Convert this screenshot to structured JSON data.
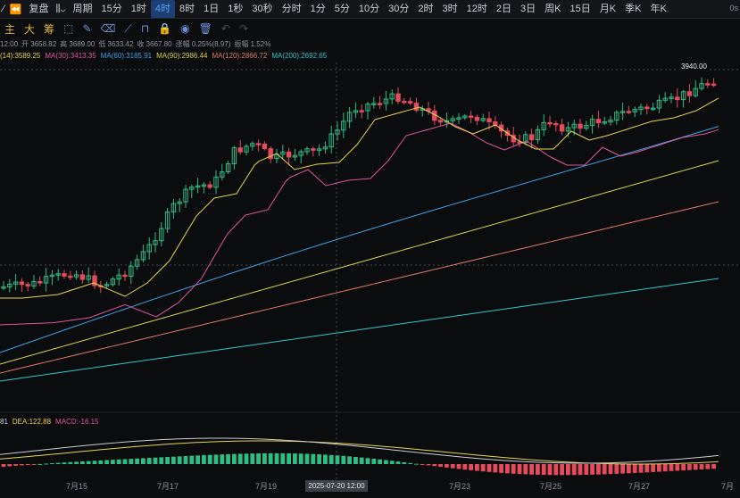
{
  "toolbar": {
    "replay_label": "复盘",
    "period_label": "周期",
    "timeframes": [
      "15分",
      "1时",
      "4时",
      "8时",
      "1日",
      "1秒",
      "30秒",
      "分时",
      "1分",
      "5分",
      "10分",
      "30分",
      "2时",
      "3时",
      "12时",
      "2日",
      "3日",
      "周K",
      "15日",
      "月K",
      "季K",
      "年K"
    ],
    "active_timeframe": "4时",
    "right_text": "0s"
  },
  "tools": {
    "indicators": [
      "主",
      "大",
      "筹"
    ]
  },
  "ohlc": {
    "time_fragment": "12:00",
    "open": "开 3658.82",
    "high": "高 3689.00",
    "low": "低 3633.42",
    "close": "收 3667.80",
    "change": "涨幅 0.25%(8.97)",
    "amplitude": "振幅 1.52%"
  },
  "ma": [
    {
      "label": "(14):3589.25",
      "color": "#e8d44d"
    },
    {
      "label": "MA(30):3413.35",
      "color": "#e0569a"
    },
    {
      "label": "MA(60):3185.91",
      "color": "#3aa0e8"
    },
    {
      "label": "MA(90):2986.44",
      "color": "#d9d24a"
    },
    {
      "label": "MA(120):2866.72",
      "color": "#e07a6a"
    },
    {
      "label": "MA(200):2692.65",
      "color": "#2ec8c8"
    }
  ],
  "macd": [
    {
      "label": "81",
      "color": "#c9ccd2"
    },
    {
      "label": "DEA:122.88",
      "color": "#e8d44d"
    },
    {
      "label": "MACD:-16.15",
      "color": "#e0569a"
    }
  ],
  "price_tag": "3940.00",
  "cursor_date": "2025-07-20 12:00",
  "x_labels": [
    "7月15",
    "7月17",
    "7月19",
    "7月23",
    "7月25",
    "7月27",
    "7月"
  ],
  "colors": {
    "up": "#2ebd85",
    "down": "#e54b5b",
    "active_tab": "#5aa2ff"
  }
}
